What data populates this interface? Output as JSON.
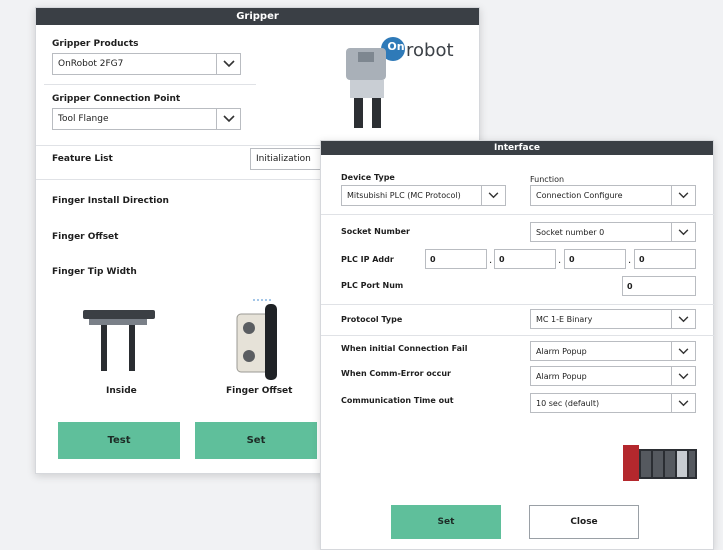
{
  "gripper": {
    "title": "Gripper",
    "products_label": "Gripper Products",
    "products_value": "OnRobot 2FG7",
    "connection_label": "Gripper Connection Point",
    "connection_value": "Tool Flange",
    "feature_label": "Feature List",
    "feature_value": "Initialization",
    "finger_install": "Finger Install Direction",
    "finger_offset": "Finger Offset",
    "finger_tip": "Finger Tip Width",
    "inside_caption": "Inside",
    "offset_caption": "Finger Offset",
    "test_label": "Test",
    "set_label": "Set",
    "logo_text": "robot",
    "logo_badge": "On"
  },
  "interface": {
    "title": "Interface",
    "device_type_label": "Device Type",
    "device_type_value": "Mitsubishi PLC (MC Protocol)",
    "function_label": "Function",
    "function_value": "Connection Configure",
    "socket_label": "Socket Number",
    "socket_value": "Socket number 0",
    "plc_ip_label": "PLC IP Addr",
    "ip": [
      "0",
      "0",
      "0",
      "0"
    ],
    "ip_sep": ".",
    "plc_port_label": "PLC Port Num",
    "plc_port_value": "0",
    "protocol_label": "Protocol Type",
    "protocol_value": "MC 1-E Binary",
    "init_fail_label": "When initial Connection Fail",
    "init_fail_value": "Alarm Popup",
    "comm_error_label": "When Comm-Error occur",
    "comm_error_value": "Alarm Popup",
    "timeout_label": "Communication Time out",
    "timeout_value": "10 sec (default)",
    "set_label": "Set",
    "close_label": "Close"
  },
  "colors": {
    "titlebar": "#3a3f45",
    "accent_green": "#5fbf9b",
    "onrobot_blue": "#2f7ab8"
  }
}
